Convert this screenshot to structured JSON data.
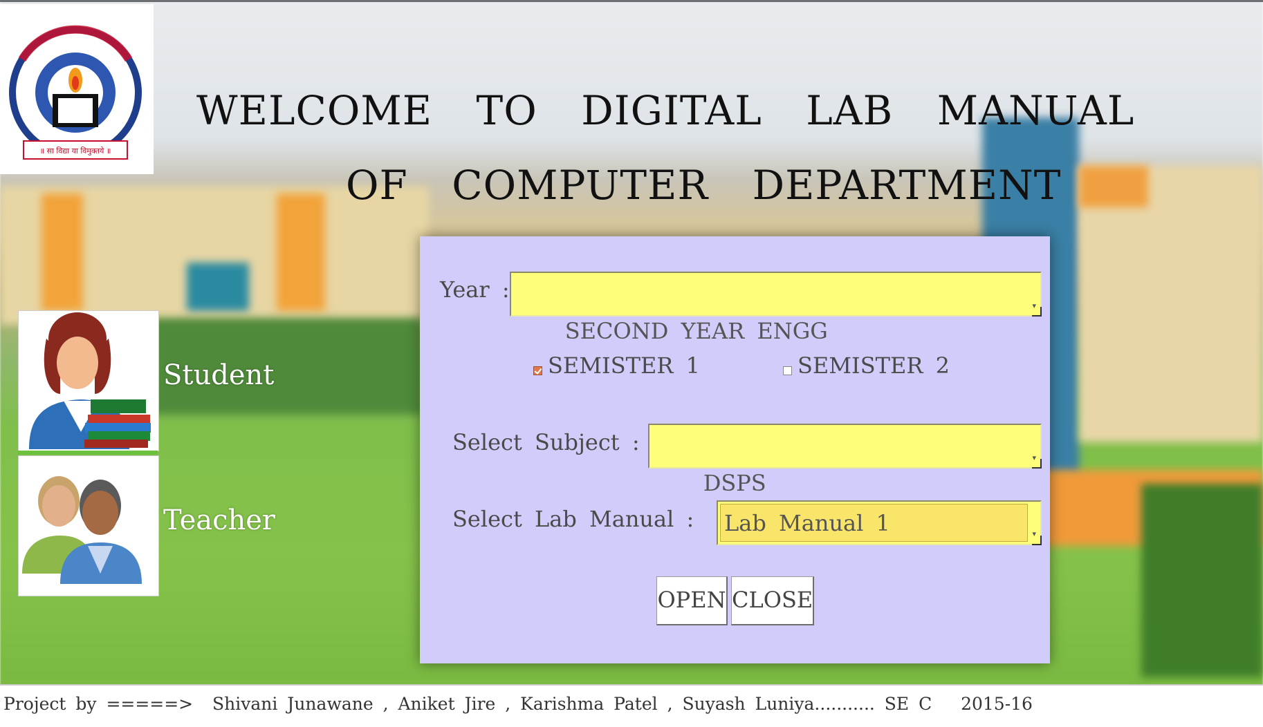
{
  "header": {
    "title_line1": "WELCOME TO DIGITAL LAB MANUAL",
    "title_line2": "OF COMPUTER DEPARTMENT",
    "logo_text": "॥ सा विद्या या विमुक्तये ॥"
  },
  "roles": {
    "student_label": "Student",
    "teacher_label": "Teacher"
  },
  "form": {
    "year_label": "Year :",
    "year_value": "SECOND YEAR ENGG",
    "semester1_label": "SEMISTER 1",
    "semester1_checked": true,
    "semester2_label": "SEMISTER 2",
    "semester2_checked": false,
    "subject_label": "Select Subject :",
    "subject_value": "DSPS",
    "lab_manual_label": "Select Lab Manual :",
    "lab_manual_value": "Lab Manual 1",
    "open_label": "OPEN",
    "close_label": "CLOSE"
  },
  "footer": {
    "credits": "Project by =====>  Shivani Junawane , Aniket Jire , Karishma Patel , Suyash Luniya........... SE C   2015-16"
  },
  "colors": {
    "panel_bg": "#d2ccfb",
    "dropdown_bg": "#fefe7a",
    "lab_manual_bg": "#f9e56a",
    "checkbox_checked": "#e07a4a"
  },
  "icons": {
    "logo": "college-logo-icon",
    "student": "student-avatar-icon",
    "teacher": "teacher-avatar-icon",
    "dropdown": "dropdown-arrow-icon"
  }
}
